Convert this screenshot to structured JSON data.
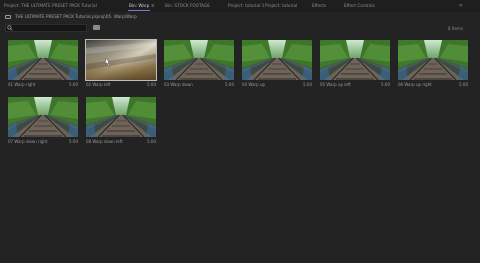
{
  "tabs": [
    {
      "label": "Project: THE ULTIMATE PRESET PACK Tutorial",
      "active": false
    },
    {
      "label": "Bin: Warp",
      "active": true
    },
    {
      "label": "Bin: STOCK FOOTAGE",
      "active": false
    },
    {
      "label": "Project: tutorial-1",
      "active": false
    },
    {
      "label": "Project: tutorial",
      "active": false
    },
    {
      "label": "Effects",
      "active": false
    },
    {
      "label": "Effect Controls",
      "active": false
    }
  ],
  "tab_menu": "≡",
  "overflow": "»",
  "path": "THE ULTIMATE PRESET PACK Tutorial.prproj\\05. Warp\\Warp",
  "search": {
    "value": "",
    "placeholder": ""
  },
  "item_count": "8 Items",
  "clips": [
    {
      "name": "01 Warp right",
      "duration": "5:00",
      "thumb": "tracks"
    },
    {
      "name": "02 Warp left",
      "duration": "5:00",
      "thumb": "blur"
    },
    {
      "name": "03 Warp down",
      "duration": "5:00",
      "thumb": "tracks"
    },
    {
      "name": "04 Warp up",
      "duration": "5:00",
      "thumb": "tracks"
    },
    {
      "name": "05 Warp up left",
      "duration": "5:00",
      "thumb": "tracks"
    },
    {
      "name": "06 Warp up right",
      "duration": "5:00",
      "thumb": "tracks"
    },
    {
      "name": "07 Warp down right",
      "duration": "5:00",
      "thumb": "tracks"
    },
    {
      "name": "08 Warp down left",
      "duration": "5:00",
      "thumb": "tracks"
    }
  ],
  "colors": {
    "accent": "#7b7bd6",
    "background": "#232323",
    "foliage": "#3f7a2c"
  }
}
